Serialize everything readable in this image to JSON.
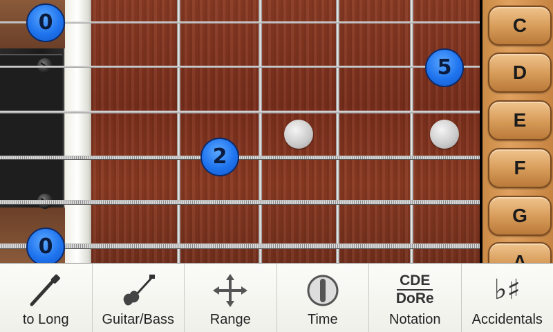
{
  "markers": [
    {
      "fret": "open",
      "string": 1,
      "label": "0"
    },
    {
      "fret": 5,
      "string": 2,
      "label": "5"
    },
    {
      "fret": 2,
      "string": 4,
      "label": "2"
    },
    {
      "fret": "open",
      "string": 6,
      "label": "0"
    }
  ],
  "note_buttons": [
    "C",
    "D",
    "E",
    "F",
    "G",
    "A"
  ],
  "toolbar": {
    "items": [
      {
        "label": "to Long",
        "icon": "guitar-neck-icon"
      },
      {
        "label": "Guitar/Bass",
        "icon": "guitar-icon"
      },
      {
        "label": "Range",
        "icon": "move-arrows-icon"
      },
      {
        "label": "Time",
        "icon": "timer-icon"
      },
      {
        "label": "Notation",
        "icon": "notation-icon",
        "icon_text_top": "CDE",
        "icon_text_bottom": "DoRe"
      },
      {
        "label": "Accidentals",
        "icon": "flat-sharp-icon",
        "icon_text": "♭♯"
      }
    ]
  },
  "colors": {
    "marker": "#1f74ee",
    "fretboard": "#7a2f1c",
    "note_button": "#d69a57"
  }
}
